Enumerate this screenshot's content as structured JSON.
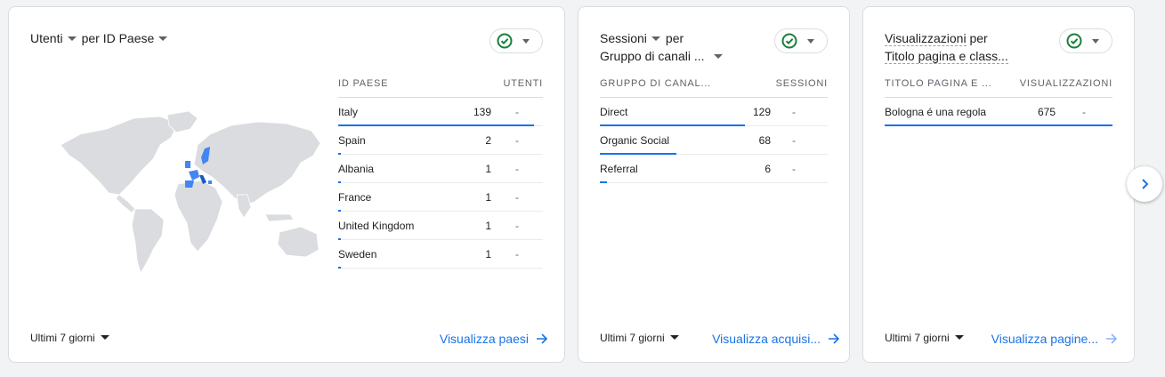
{
  "colors": {
    "accent": "#1a73e8",
    "success": "#188038",
    "map_land": "#dadce0",
    "map_highlight": "#4285f4"
  },
  "card_users": {
    "metric": "Utenti",
    "joiner": "per",
    "dimension": "ID Paese",
    "status_icon": "check-circle-icon",
    "columns": [
      "ID PAESE",
      "UTENTI"
    ],
    "rows": [
      {
        "name": "Italy",
        "value": "139",
        "change": "-",
        "share": 1.0
      },
      {
        "name": "Spain",
        "value": "2",
        "change": "-",
        "share": 0.014
      },
      {
        "name": "Albania",
        "value": "1",
        "change": "-",
        "share": 0.007
      },
      {
        "name": "France",
        "value": "1",
        "change": "-",
        "share": 0.007
      },
      {
        "name": "United Kingdom",
        "value": "1",
        "change": "-",
        "share": 0.007
      },
      {
        "name": "Sweden",
        "value": "1",
        "change": "-",
        "share": 0.007
      }
    ],
    "date_range": "Ultimi 7 giorni",
    "link": "Visualizza paesi"
  },
  "card_sessions": {
    "metric": "Sessioni",
    "joiner": "per",
    "dimension": "Gruppo di canali ...",
    "status_icon": "check-circle-icon",
    "columns": [
      "GRUPPO DI CANAL...",
      "SESSIONI"
    ],
    "rows": [
      {
        "name": "Direct",
        "value": "129",
        "change": "-",
        "share": 1.0
      },
      {
        "name": "Organic Social",
        "value": "68",
        "change": "-",
        "share": 0.527
      },
      {
        "name": "Referral",
        "value": "6",
        "change": "-",
        "share": 0.047
      }
    ],
    "date_range": "Ultimi 7 giorni",
    "link": "Visualizza acquisi..."
  },
  "card_views": {
    "metric": "Visualizzazioni",
    "joiner": "per",
    "dimension": "Titolo pagina e class...",
    "status_icon": "check-circle-icon",
    "columns": [
      "TITOLO PAGINA E ...",
      "VISUALIZZAZIONI"
    ],
    "rows": [
      {
        "name": "Bologna é una regola",
        "value": "675",
        "change": "-",
        "share": 1.0
      }
    ],
    "date_range": "Ultimi 7 giorni",
    "link": "Visualizza pagine..."
  },
  "nav": {
    "next_icon": "chevron-right-icon"
  }
}
